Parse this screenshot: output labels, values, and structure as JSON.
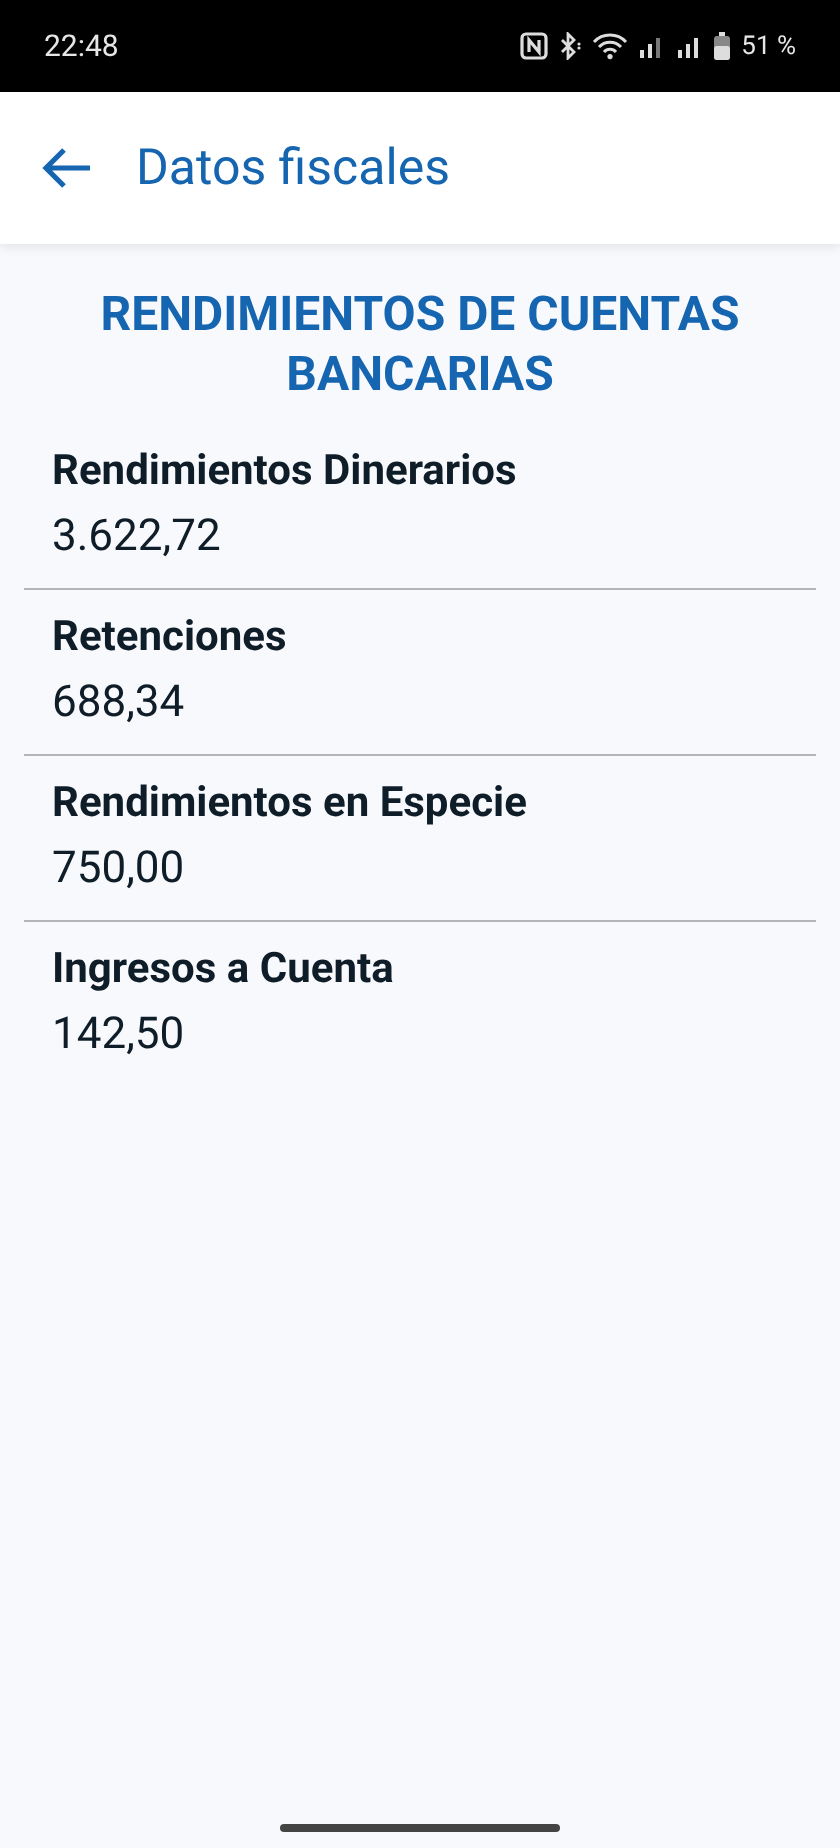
{
  "status_bar": {
    "time": "22:48",
    "battery": "51 %"
  },
  "app_bar": {
    "title": "Datos fiscales"
  },
  "section_title": "RENDIMIENTOS DE CUENTAS BANCARIAS",
  "items": [
    {
      "label": "Rendimientos Dinerarios",
      "value": "3.622,72"
    },
    {
      "label": "Retenciones",
      "value": "688,34"
    },
    {
      "label": "Rendimientos en Especie",
      "value": "750,00"
    },
    {
      "label": "Ingresos a Cuenta",
      "value": "142,50"
    }
  ]
}
